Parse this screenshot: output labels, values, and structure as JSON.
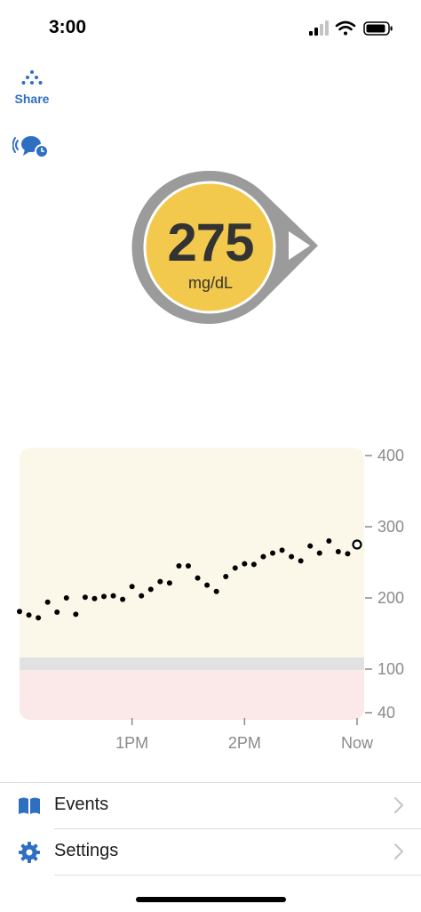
{
  "status_bar": {
    "time": "3:00",
    "icons": [
      "cellular-signal-icon",
      "wifi-icon",
      "battery-icon"
    ]
  },
  "share": {
    "label": "Share",
    "icon": "share-dots-icon"
  },
  "alert": {
    "icon": "speaking-alert-icon"
  },
  "reading": {
    "value": "275",
    "unit": "mg/dL",
    "trend": "steady",
    "colors": {
      "fill": "#f2c94c",
      "ring": "#9b9b9b"
    }
  },
  "chart_data": {
    "type": "scatter",
    "title": "",
    "xlabel": "",
    "ylabel": "",
    "x_ticks": [
      "1PM",
      "2PM",
      "Now"
    ],
    "y_ticks": [
      400,
      300,
      200,
      100,
      40
    ],
    "xlim_minutes": [
      -180,
      0
    ],
    "high_threshold": 130,
    "low_threshold": 100,
    "series": [
      {
        "x": [
          -180,
          -175,
          -170,
          -165,
          -160,
          -155,
          -150,
          -145,
          -140,
          -135,
          -130,
          -125,
          -120,
          -115,
          -110,
          -105,
          -100,
          -95,
          -90,
          -85,
          -80,
          -75,
          -70,
          -65,
          -60,
          -55,
          -50,
          -45,
          -40,
          -35,
          -30,
          -25,
          -20,
          -15,
          -10,
          -5,
          0
        ],
        "y": [
          181,
          176,
          172,
          194,
          180,
          200,
          177,
          201,
          199,
          202,
          203,
          198,
          216,
          203,
          212,
          223,
          221,
          245,
          245,
          228,
          218,
          209,
          230,
          242,
          248,
          247,
          258,
          263,
          267,
          258,
          252,
          273,
          263,
          280,
          265,
          262,
          275
        ]
      }
    ],
    "current_point": {
      "x": 0,
      "y": 275
    },
    "colors": {
      "high_zone": "#fbf8e9",
      "target_band": "#e1e1e1",
      "low_zone": "#fbe8e8",
      "points": "#000000"
    }
  },
  "menu": {
    "events": {
      "label": "Events",
      "icon": "book-icon"
    },
    "settings": {
      "label": "Settings",
      "icon": "gear-icon"
    }
  }
}
